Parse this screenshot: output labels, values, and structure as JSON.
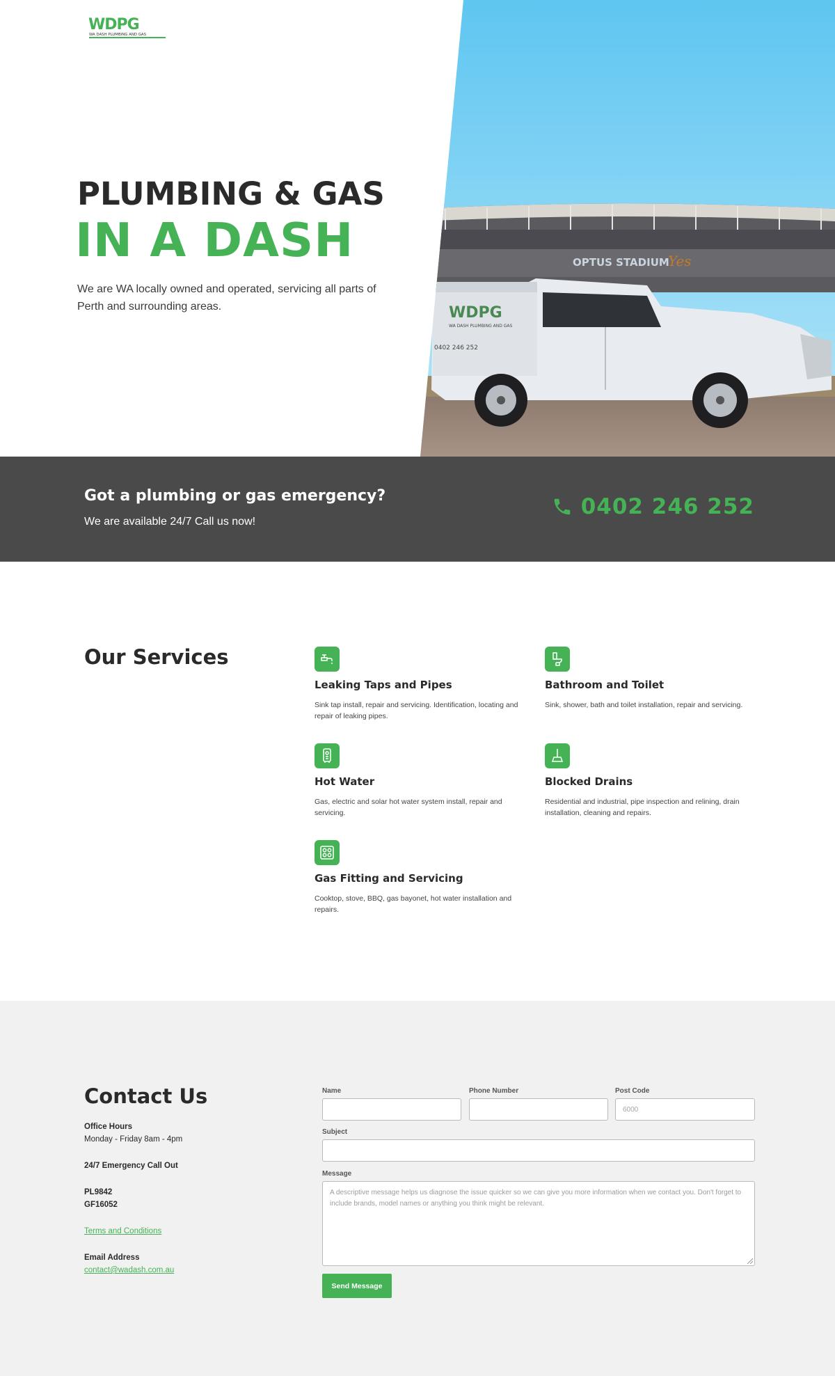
{
  "brand": {
    "logo_text": "WDPG",
    "logo_tagline": "WA DASH PLUMBING AND GAS",
    "accent_color": "#45b255",
    "dark_color": "#4a4a4a"
  },
  "hero": {
    "title": "PLUMBING & GAS",
    "subtitle": "IN A DASH",
    "description": "We are WA locally owned and operated, servicing all parts of Perth and surrounding areas.",
    "photo": {
      "stadium_sign": "OPTUS STADIUM",
      "ute_logo": "WDPG",
      "ute_tagline": "WA DASH PLUMBING AND GAS",
      "ute_phone": "0402 246 252"
    }
  },
  "emergency": {
    "title": "Got a plumbing or gas emergency?",
    "subtitle": "We are available 24/7 Call us now!",
    "phone": "0402 246 252",
    "phone_icon": "phone-icon"
  },
  "services": {
    "title": "Our Services",
    "items": [
      {
        "icon": "tap-icon",
        "title": "Leaking Taps and Pipes",
        "description": "Sink tap install, repair and servicing. Identification, locating and repair of leaking pipes."
      },
      {
        "icon": "toilet-icon",
        "title": "Bathroom and Toilet",
        "description": "Sink, shower, bath and toilet installation, repair and servicing."
      },
      {
        "icon": "water-heater-icon",
        "title": "Hot Water",
        "description": "Gas, electric and solar hot water system install, repair and servicing."
      },
      {
        "icon": "plunger-icon",
        "title": "Blocked Drains",
        "description": "Residential and industrial, pipe inspection and relining, drain installation, cleaning and repairs."
      },
      {
        "icon": "cooktop-icon",
        "title": "Gas Fitting and Servicing",
        "description": "Cooktop, stove, BBQ, gas bayonet, hot water installation and repairs."
      }
    ]
  },
  "contact": {
    "title": "Contact Us",
    "office_hours_label": "Office Hours",
    "office_hours": "Monday - Friday 8am - 4pm",
    "emergency_label": "24/7 Emergency Call Out",
    "license_1": "PL9842",
    "license_2": "GF16052",
    "terms_link": "Terms and Conditions",
    "email_label": "Email Address",
    "email": "contact@wadash.com.au",
    "form": {
      "name_label": "Name",
      "name_value": "",
      "phone_label": "Phone Number",
      "phone_value": "",
      "postcode_label": "Post Code",
      "postcode_placeholder": "6000",
      "subject_label": "Subject",
      "subject_value": "",
      "message_label": "Message",
      "message_placeholder": "A descriptive message helps us diagnose the issue quicker so we can give you more information when we contact you. Don't forget to include brands, model names or anything you think might be relevant.",
      "submit_label": "Send Message"
    }
  }
}
